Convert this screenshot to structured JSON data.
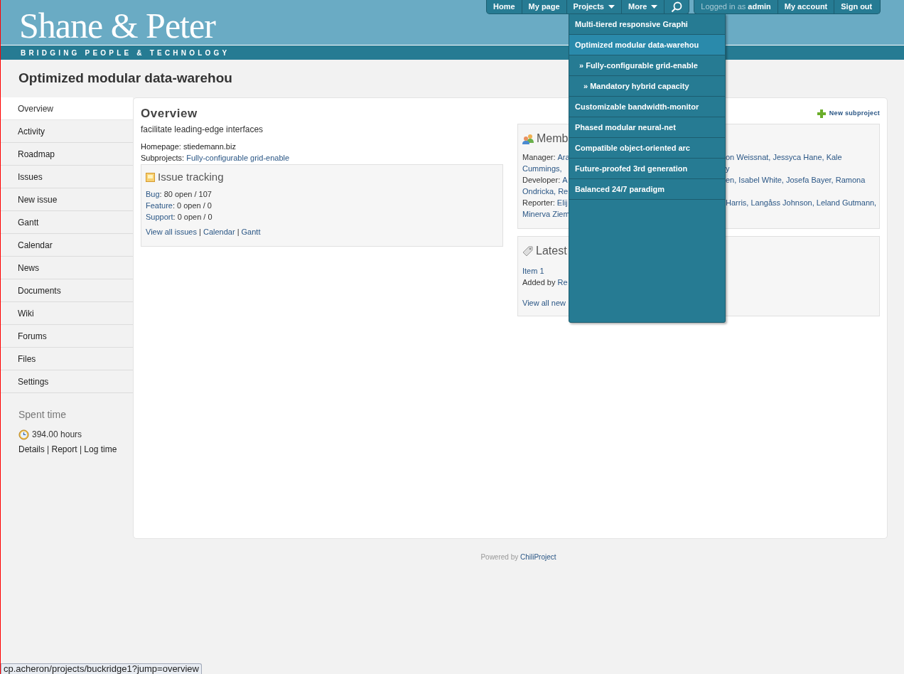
{
  "header": {
    "logo": "Shane & Peter",
    "tagline": "BRIDGING PEOPLE & TECHNOLOGY"
  },
  "top_menu": [
    {
      "label": "Home",
      "kind": "link"
    },
    {
      "label": "My page",
      "kind": "link"
    },
    {
      "label": "Projects",
      "kind": "dropdown"
    },
    {
      "label": "More",
      "kind": "dropdown"
    },
    {
      "kind": "search"
    }
  ],
  "separator": "|",
  "account": {
    "prefix": "Logged in as",
    "user": "admin",
    "links": [
      "My account",
      "Sign out"
    ]
  },
  "projects_menu": [
    {
      "label": "Multi-tiered responsive Graphi",
      "selected": false
    },
    {
      "label": "Optimized modular data-warehou",
      "selected": true,
      "children": [
        {
          "label": "» Fully-configurable grid-enable",
          "selected": false,
          "children": [
            {
              "label": "» Mandatory hybrid capacity",
              "selected": false
            }
          ]
        }
      ]
    },
    {
      "label": "Customizable bandwidth-monitor",
      "selected": false
    },
    {
      "label": "Phased modular neural-net",
      "selected": false
    },
    {
      "label": "Compatible object-oriented arc",
      "selected": false
    },
    {
      "label": "Future-proofed 3rd generation",
      "selected": false
    },
    {
      "label": "Balanced 24/7 paradigm",
      "selected": false
    }
  ],
  "page_title": "Optimized modular data-warehou",
  "sidebar": {
    "items": [
      {
        "label": "Overview",
        "selected": true
      },
      {
        "label": "Activity",
        "selected": false
      },
      {
        "label": "Roadmap",
        "selected": false
      },
      {
        "label": "Issues",
        "selected": false
      },
      {
        "label": "New issue",
        "selected": false
      },
      {
        "label": "Gantt",
        "selected": false
      },
      {
        "label": "Calendar",
        "selected": false
      },
      {
        "label": "News",
        "selected": false
      },
      {
        "label": "Documents",
        "selected": false
      },
      {
        "label": "Wiki",
        "selected": false
      },
      {
        "label": "Forums",
        "selected": false
      },
      {
        "label": "Files",
        "selected": false
      },
      {
        "label": "Settings",
        "selected": false
      }
    ],
    "spent_time": {
      "title": "Spent time",
      "hours": "394.00 hours",
      "links": [
        "Details",
        "Report",
        "Log time"
      ]
    }
  },
  "overview": {
    "title": "Overview",
    "new_subproject": "New subproject",
    "description": "facilitate leading-edge interfaces",
    "homepage_label": "Homepage:",
    "homepage": "stiedemann.biz",
    "subprojects_label": "Subprojects:",
    "subprojects": "Fully-configurable grid-enable",
    "issue_tracking": {
      "title": "Issue tracking",
      "trackers": [
        {
          "name": "Bug",
          "count": ": 80 open / 107"
        },
        {
          "name": "Feature",
          "count": ": 0 open / 0"
        },
        {
          "name": "Support",
          "count": ": 0 open / 0"
        }
      ],
      "links": [
        "View all issues",
        "Calendar",
        "Gantt"
      ]
    },
    "members": {
      "title": "Memb",
      "lines": [
        {
          "role": "Manager:",
          "left": "Ara",
          "right": "on Weissnat, Jessyca Hane, Kale"
        },
        {
          "left": "Cummings,",
          "right": "y"
        },
        {
          "role": "Developer:",
          "left": "A",
          "right": "en, Isabel White, Josefa Bayer, Ramona"
        },
        {
          "left": "Ondricka, Re"
        },
        {
          "role": "Reporter:",
          "left": "Elij",
          "right": "Harris, Langåss Johnson, Leland Gutmann,"
        },
        {
          "left": "Minerva Ziem"
        }
      ]
    },
    "news": {
      "title": "Latest",
      "item": "Item 1",
      "added_by": "Added by",
      "author": "Re",
      "view_all": "View all new"
    }
  },
  "footer": {
    "prefix": "Powered by",
    "link": "ChiliProject"
  },
  "status_url": "cp.acheron/projects/buckridge1?jump=overview"
}
